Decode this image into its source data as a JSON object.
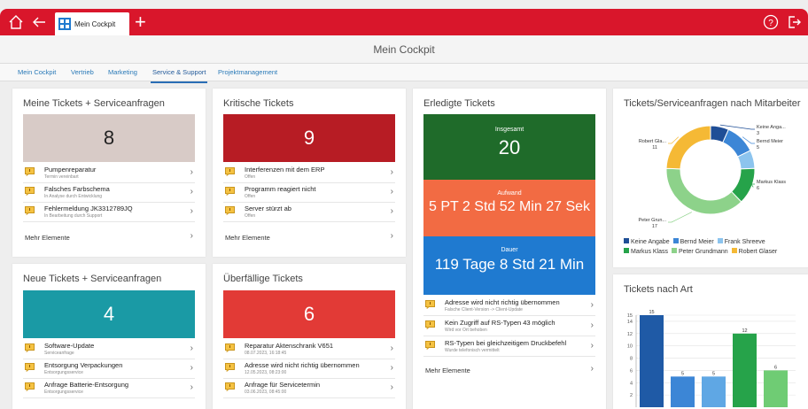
{
  "app": {
    "tab_label": "Mein Cockpit",
    "page_title": "Mein Cockpit"
  },
  "nav": {
    "items": [
      {
        "label": "Mein Cockpit"
      },
      {
        "label": "Vertrieb"
      },
      {
        "label": "Marketing"
      },
      {
        "label": "Service & Support"
      },
      {
        "label": "Projektmanagement"
      }
    ],
    "active": "Service & Support"
  },
  "meine_tickets": {
    "title": "Meine Tickets + Serviceanfragen",
    "count": "8",
    "tile_color": "#d8cbc7",
    "items": [
      {
        "title": "Pumpenreparatur",
        "sub": "Termin vereinbart"
      },
      {
        "title": "Falsches Farbschema",
        "sub": "In Analyse durch Entwicklung"
      },
      {
        "title": "Fehlermeldung JK3312789JQ",
        "sub": "In Bearbeitung durch Support"
      }
    ],
    "more": "Mehr Elemente"
  },
  "kritische_tickets": {
    "title": "Kritische Tickets",
    "count": "9",
    "tile_color": "#b71c24",
    "items": [
      {
        "title": "Interferenzen mit dem ERP",
        "sub": "Offen"
      },
      {
        "title": "Programm reagiert nicht",
        "sub": "Offen"
      },
      {
        "title": "Server stürzt ab",
        "sub": "Offen"
      }
    ],
    "more": "Mehr Elemente"
  },
  "erledigte_tickets": {
    "title": "Erledigte Tickets",
    "insgesamt_label": "Insgesamt",
    "insgesamt_value": "20",
    "aufwand_label": "Aufwand",
    "aufwand_value": "5 PT 2 Std 52 Min 27 Sek",
    "dauer_label": "Dauer",
    "dauer_value": "119 Tage 8 Std 21 Min",
    "items": [
      {
        "title": "Adresse wird nicht richtig übernommen",
        "sub": "Falsche Client-Version -> Client-Update"
      },
      {
        "title": "Kein Zugriff auf RS-Typen 43 möglich",
        "sub": "Wird vor Ort behoben"
      },
      {
        "title": "RS-Typen bei gleichzeitigem Druckbefehl",
        "sub": "Wurde telefonisch vermittelt"
      }
    ],
    "more": "Mehr Elemente",
    "colors": {
      "insgesamt": "#1f6b2a",
      "aufwand": "#f26b43",
      "dauer": "#1f7ad0"
    }
  },
  "neue_tickets": {
    "title": "Neue Tickets + Serviceanfragen",
    "count": "4",
    "tile_color": "#1a9aa5",
    "items": [
      {
        "title": "Software-Update",
        "sub": "Serviceanfrage"
      },
      {
        "title": "Entsorgung Verpackungen",
        "sub": "Entsorgungsservice"
      },
      {
        "title": "Anfrage Batterie-Entsorgung",
        "sub": "Entsorgungsservice"
      }
    ]
  },
  "ueberfaellige_tickets": {
    "title": "Überfällige Tickets",
    "count": "6",
    "tile_color": "#e23a36",
    "items": [
      {
        "title": "Reparatur Aktenschrank V651",
        "sub": "08.07.2023, 16:18:45"
      },
      {
        "title": "Adresse wird nicht richtig übernommen",
        "sub": "12.05.2023, 08:23:00"
      },
      {
        "title": "Anfrage für Servicetermin",
        "sub": "03.06.2023, 08:45:00"
      }
    ]
  },
  "mitarbeiter_chart": {
    "title": "Tickets/Serviceanfragen nach Mitarbeiter",
    "chart_data": {
      "type": "pie",
      "title": "Tickets/Serviceanfragen nach Mitarbeiter",
      "categories": [
        "Keine Angabe",
        "Bernd Meier",
        "Frank Shreeve",
        "Markus Klass",
        "Peter Grundmann",
        "Robert Glaser"
      ],
      "values": [
        3,
        5,
        3,
        6,
        17,
        11
      ],
      "colors": [
        "#1f4e96",
        "#3c86d6",
        "#8cc4ee",
        "#26a34a",
        "#8dd28a",
        "#f5b935"
      ],
      "slice_labels": [
        {
          "name": "Keine Anga...",
          "value": "3"
        },
        {
          "name": "Bernd Meier",
          "value": "5"
        },
        {
          "name": "Markus Klass",
          "value": "6"
        },
        {
          "name": "Peter Grun...",
          "value": "17"
        },
        {
          "name": "Robert Gla...",
          "value": "11"
        }
      ],
      "legend": "bottom",
      "donut": true
    }
  },
  "art_chart": {
    "title": "Tickets nach Art",
    "chart_data": {
      "type": "bar",
      "title": "Tickets nach Art",
      "values": [
        15,
        5,
        5,
        12,
        6
      ],
      "colors": [
        "#1f5aa6",
        "#3c86d6",
        "#5fa7e4",
        "#26a34a",
        "#6fcc74"
      ],
      "y_ticks": [
        2,
        4,
        6,
        8,
        10,
        12,
        14,
        15
      ],
      "ylim": [
        0,
        15
      ],
      "grid": true
    }
  }
}
